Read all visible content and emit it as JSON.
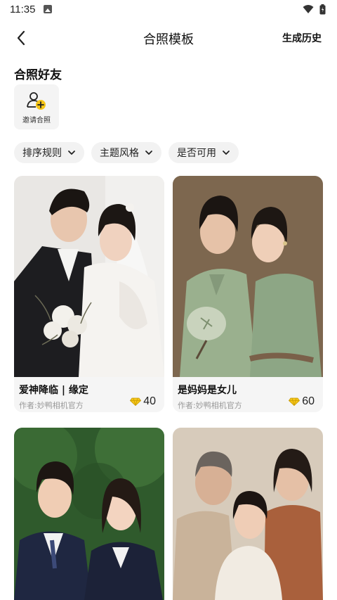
{
  "status_bar": {
    "time": "11:35"
  },
  "header": {
    "title": "合照模板",
    "history_label": "生成历史"
  },
  "friends": {
    "section_title": "合照好友",
    "invite_label": "邀请合照"
  },
  "filters": [
    {
      "label": "排序规则"
    },
    {
      "label": "主题风格"
    },
    {
      "label": "是否可用"
    }
  ],
  "templates": [
    {
      "name": "爱神降临 | 缘定",
      "author": "作者:妙鸭相机官方",
      "price": "40"
    },
    {
      "name": "是妈妈是女儿",
      "author": "作者:妙鸭相机官方",
      "price": "60"
    }
  ],
  "colors": {
    "accent": "#f5c518",
    "chip_bg": "#f2f2f2",
    "card_bg": "#f5f5f5"
  }
}
